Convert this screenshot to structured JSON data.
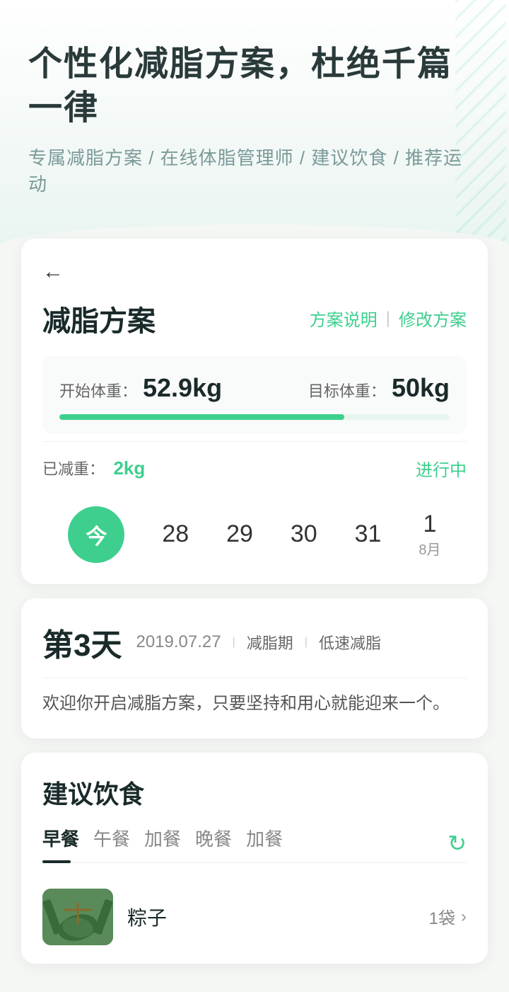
{
  "header": {
    "main_title": "个性化减脂方案，杜绝千篇一律",
    "subtitle": "专属减脂方案 / 在线体脂管理师 / 建议饮食 / 推荐运动"
  },
  "plan_card": {
    "back_icon": "←",
    "title": "减脂方案",
    "action_plan": "方案说明",
    "action_divider": "|",
    "action_modify": "修改方案",
    "start_label": "开始体重：",
    "start_value": "52.9kg",
    "target_label": "目标体重：",
    "target_value": "50kg",
    "progress_percent": 73,
    "lost_label": "已减重：",
    "lost_value": "2kg",
    "status": "进行中"
  },
  "calendar": {
    "today_label": "今",
    "days": [
      {
        "day": "28",
        "month": ""
      },
      {
        "day": "29",
        "month": ""
      },
      {
        "day": "30",
        "month": ""
      },
      {
        "day": "31",
        "month": ""
      },
      {
        "day": "1",
        "month": "8月"
      }
    ]
  },
  "day_info": {
    "day_number": "第3天",
    "date": "2019.07.27",
    "divider1": "|",
    "tag1": "减脂期",
    "divider2": "|",
    "tag2": "低速减脂",
    "welcome_text": "欢迎你开启减脂方案，只要坚持和用心就能迎来一个。"
  },
  "food_section": {
    "title": "建议饮食",
    "tabs": [
      {
        "label": "早餐",
        "active": true
      },
      {
        "label": "午餐",
        "active": false
      },
      {
        "label": "加餐",
        "active": false
      },
      {
        "label": "晚餐",
        "active": false
      },
      {
        "label": "加餐",
        "active": false
      }
    ],
    "refresh_icon": "↻",
    "food_items": [
      {
        "name": "粽子",
        "qty": "1袋",
        "arrow": "›"
      }
    ]
  }
}
